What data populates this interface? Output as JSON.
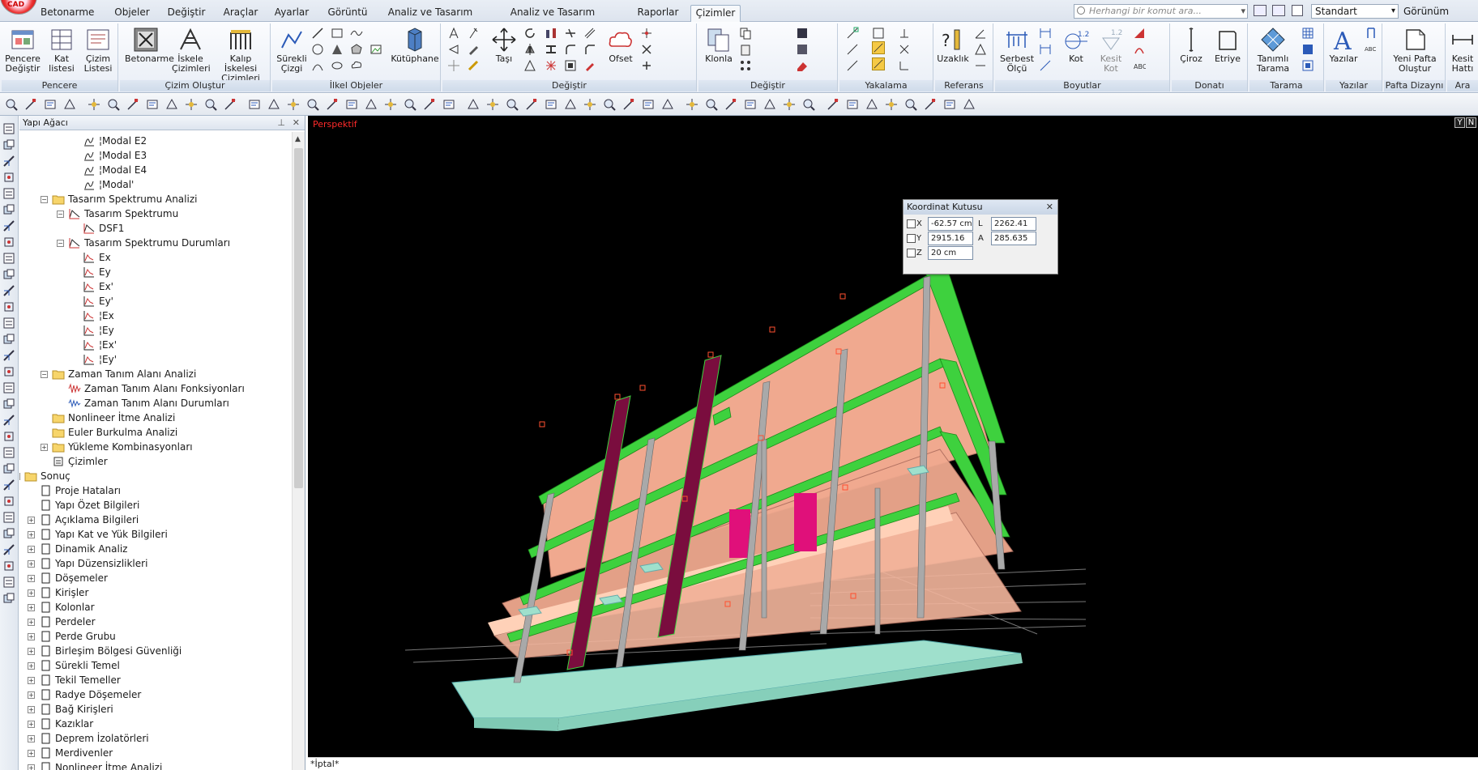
{
  "app": {
    "logo_text": "CAD"
  },
  "tabs": [
    {
      "label": "Betonarme"
    },
    {
      "label": "Objeler"
    },
    {
      "label": "Değiştir"
    },
    {
      "label": "Araçlar"
    },
    {
      "label": "Ayarlar"
    },
    {
      "label": "Görüntü"
    },
    {
      "label": "Analiz ve Tasarım"
    },
    {
      "label": "Analiz ve Tasarım Görüntüleme"
    },
    {
      "label": "Raporlar"
    },
    {
      "label": "Çizimler",
      "active": true
    }
  ],
  "search": {
    "placeholder": "Herhangi bir komut ara..."
  },
  "style_combo": {
    "value": "Standart"
  },
  "view_label": "Görünüm",
  "ribbon": {
    "groups": [
      {
        "title": "Pencere",
        "buttons": [
          "Pencere Değiştir",
          "Kat listesi",
          "Çizim Listesi"
        ]
      },
      {
        "title": "Çizim Oluştur",
        "buttons": [
          "Betonarme",
          "İskele Çizimleri",
          "Kalıp İskelesi Çizimleri"
        ]
      },
      {
        "title": "İlkel Objeler",
        "buttons": [
          "Sürekli Çizgi",
          "Kütüphane"
        ]
      },
      {
        "title": "Değiştir",
        "buttons": [
          "Taşı",
          "Ofset"
        ]
      },
      {
        "title": "Değiştir",
        "buttons": [
          "Klonla"
        ]
      },
      {
        "title": "Yakalama",
        "buttons": []
      },
      {
        "title": "Referans",
        "buttons": [
          "Uzaklık"
        ]
      },
      {
        "title": "Boyutlar",
        "buttons": [
          "Serbest Ölçü",
          "Kot",
          "Kesit Kot"
        ]
      },
      {
        "title": "Donatı",
        "buttons": [
          "Çiroz",
          "Etriye"
        ]
      },
      {
        "title": "Tarama",
        "buttons": [
          "Tanımlı Tarama"
        ]
      },
      {
        "title": "Yazılar",
        "buttons": [
          "Yazılar"
        ]
      },
      {
        "title": "Pafta Dizaynı",
        "buttons": [
          "Yeni Pafta Oluştur"
        ]
      },
      {
        "title": "Ara",
        "buttons": [
          "Kesit Hattı"
        ]
      }
    ]
  },
  "tree": {
    "title": "Yapı Ağacı",
    "items": [
      {
        "label": "¦Modal E2",
        "level": 5,
        "icon": "modal-icon"
      },
      {
        "label": "¦Modal E3",
        "level": 5,
        "icon": "modal-icon"
      },
      {
        "label": "¦Modal E4",
        "level": 5,
        "icon": "modal-icon"
      },
      {
        "label": "¦Modal'",
        "level": 5,
        "icon": "modal-icon"
      },
      {
        "label": "Tasarım Spektrumu Analizi",
        "level": 3,
        "icon": "folder-icon",
        "expanded": true
      },
      {
        "label": "Tasarım Spektrumu",
        "level": 4,
        "icon": "spectrum-icon",
        "expanded": true
      },
      {
        "label": "DSF1",
        "level": 5,
        "icon": "spectrum-icon"
      },
      {
        "label": "Tasarım Spektrumu Durumları",
        "level": 4,
        "icon": "spectrum-icon",
        "expanded": true
      },
      {
        "label": "Ex",
        "level": 5,
        "icon": "case-icon"
      },
      {
        "label": "Ey",
        "level": 5,
        "icon": "case-icon"
      },
      {
        "label": "Ex'",
        "level": 5,
        "icon": "case-icon"
      },
      {
        "label": "Ey'",
        "level": 5,
        "icon": "case-icon"
      },
      {
        "label": "¦Ex",
        "level": 5,
        "icon": "case-icon"
      },
      {
        "label": "¦Ey",
        "level": 5,
        "icon": "case-icon"
      },
      {
        "label": "¦Ex'",
        "level": 5,
        "icon": "case-icon"
      },
      {
        "label": "¦Ey'",
        "level": 5,
        "icon": "case-icon"
      },
      {
        "label": "Zaman Tanım Alanı Analizi",
        "level": 3,
        "icon": "folder-icon",
        "expanded": true
      },
      {
        "label": "Zaman Tanım Alanı Fonksiyonları",
        "level": 4,
        "icon": "time-function-icon"
      },
      {
        "label": "Zaman Tanım Alanı Durumları",
        "level": 4,
        "icon": "time-case-icon"
      },
      {
        "label": "Nonlineer İtme Analizi",
        "level": 3,
        "icon": "folder-icon"
      },
      {
        "label": "Euler Burkulma Analizi",
        "level": 3,
        "icon": "folder-icon"
      },
      {
        "label": "Yükleme Kombinasyonları",
        "level": 3,
        "icon": "folder-icon",
        "collapsed": true
      },
      {
        "label": "Çizimler",
        "level": 3,
        "icon": "drawing-icon"
      },
      {
        "label": "Sonuç",
        "level": 1,
        "icon": "folder-icon",
        "expanded": true
      },
      {
        "label": "Proje Hataları",
        "level": 2,
        "icon": "page-icon"
      },
      {
        "label": "Yapı Özet Bilgileri",
        "level": 2,
        "icon": "page-icon"
      },
      {
        "label": "Açıklama Bilgileri",
        "level": 2,
        "icon": "page-icon",
        "collapsed": true
      },
      {
        "label": "Yapı Kat ve Yük Bilgileri",
        "level": 2,
        "icon": "page-icon",
        "collapsed": true
      },
      {
        "label": "Dinamik Analiz",
        "level": 2,
        "icon": "page-icon",
        "collapsed": true
      },
      {
        "label": "Yapı Düzensizlikleri",
        "level": 2,
        "icon": "page-icon",
        "collapsed": true
      },
      {
        "label": "Döşemeler",
        "level": 2,
        "icon": "page-icon",
        "collapsed": true
      },
      {
        "label": "Kirişler",
        "level": 2,
        "icon": "page-icon",
        "collapsed": true
      },
      {
        "label": "Kolonlar",
        "level": 2,
        "icon": "page-icon",
        "collapsed": true
      },
      {
        "label": "Perdeler",
        "level": 2,
        "icon": "page-icon",
        "collapsed": true
      },
      {
        "label": "Perde Grubu",
        "level": 2,
        "icon": "page-icon",
        "collapsed": true
      },
      {
        "label": "Birleşim Bölgesi Güvenliği",
        "level": 2,
        "icon": "page-icon",
        "collapsed": true
      },
      {
        "label": "Sürekli Temel",
        "level": 2,
        "icon": "page-icon",
        "collapsed": true
      },
      {
        "label": "Tekil Temeller",
        "level": 2,
        "icon": "page-icon",
        "collapsed": true
      },
      {
        "label": "Radye Döşemeler",
        "level": 2,
        "icon": "page-icon",
        "collapsed": true
      },
      {
        "label": "Bağ Kirişleri",
        "level": 2,
        "icon": "page-icon",
        "collapsed": true
      },
      {
        "label": "Kazıklar",
        "level": 2,
        "icon": "page-icon",
        "collapsed": true
      },
      {
        "label": "Deprem İzolatörleri",
        "level": 2,
        "icon": "page-icon",
        "collapsed": true
      },
      {
        "label": "Merdivenler",
        "level": 2,
        "icon": "page-icon",
        "collapsed": true
      },
      {
        "label": "Nonlineer İtme Analizi",
        "level": 2,
        "icon": "page-icon",
        "collapsed": true
      }
    ]
  },
  "viewport": {
    "label": "Perspektif",
    "icons": [
      "Y",
      "N"
    ]
  },
  "coordinate_box": {
    "title": "Koordinat Kutusu",
    "x_label": "X",
    "x_value": "-62.57 cm",
    "y_label": "Y",
    "y_value": "2915.16 cm",
    "z_label": "Z",
    "z_value": "20 cm",
    "l_label": "L",
    "l_value": "2262.41 cm",
    "a_label": "A",
    "a_value": "285.635"
  },
  "status": {
    "text": "*İptal*"
  },
  "colors": {
    "beam": "#3ed13e",
    "slab": "#f0a98f",
    "column": "#a9a9a9",
    "shear_wall": "#7a0d3e",
    "foundation": "#9fe0cc",
    "background": "#000000"
  }
}
